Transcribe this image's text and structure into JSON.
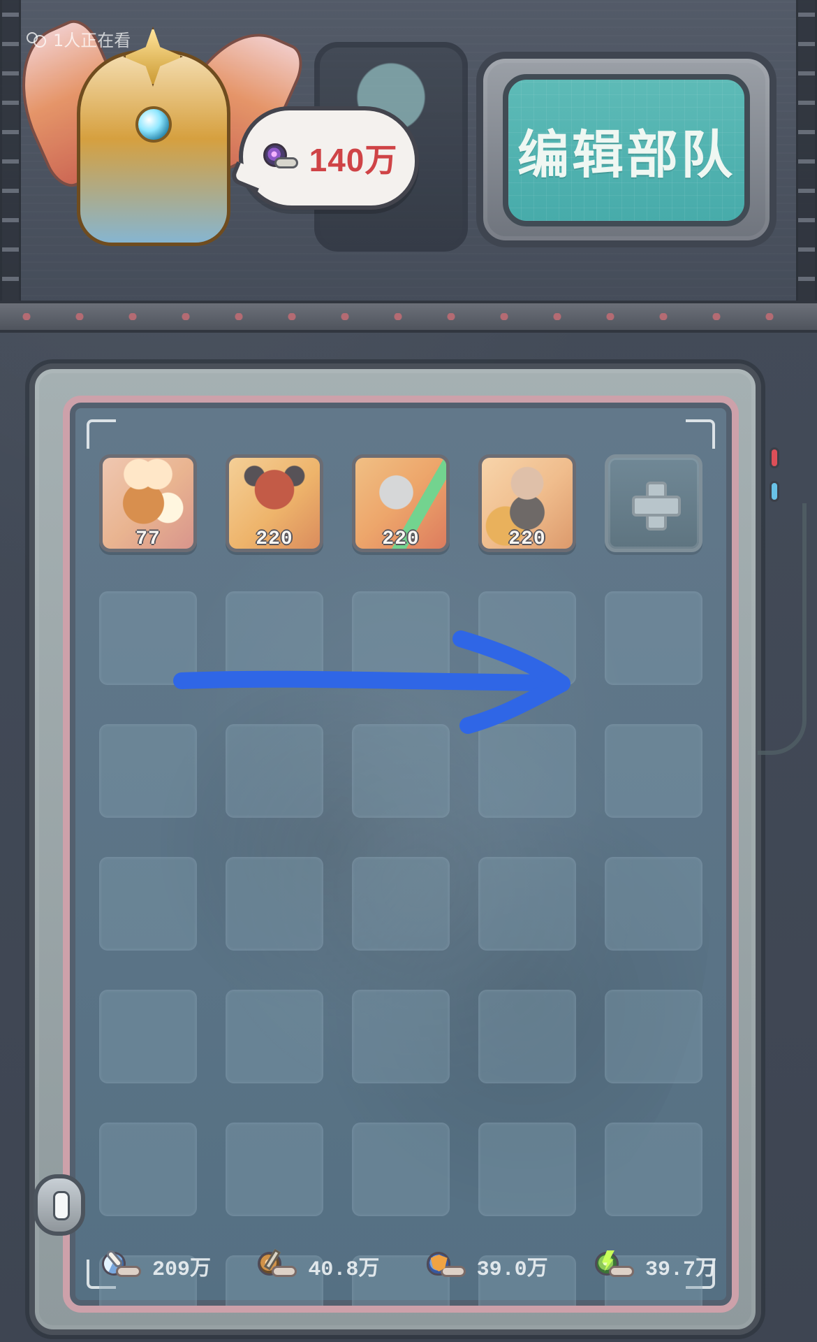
{
  "viewer": {
    "text": "1人正在看",
    "icon": "viewer-icon"
  },
  "header": {
    "power_value": "140万",
    "power_icon": "snail-power-icon",
    "title": "编辑部队"
  },
  "team": {
    "slots": [
      {
        "level": "77"
      },
      {
        "level": "220"
      },
      {
        "level": "220"
      },
      {
        "level": "220"
      }
    ],
    "add_icon": "plus-icon"
  },
  "stats": {
    "hp": {
      "value": "209万",
      "icon": "health-snail-icon"
    },
    "attack": {
      "value": "40.8万",
      "icon": "attack-snail-icon"
    },
    "defense": {
      "value": "39.0万",
      "icon": "defense-snail-icon"
    },
    "speed": {
      "value": "39.7万",
      "icon": "speed-snail-icon"
    }
  },
  "colors": {
    "accent_red": "#cf4346",
    "screen_teal": "#3da7a6",
    "panel_blue": "#557083",
    "arrow_blue": "#2f66e6"
  }
}
